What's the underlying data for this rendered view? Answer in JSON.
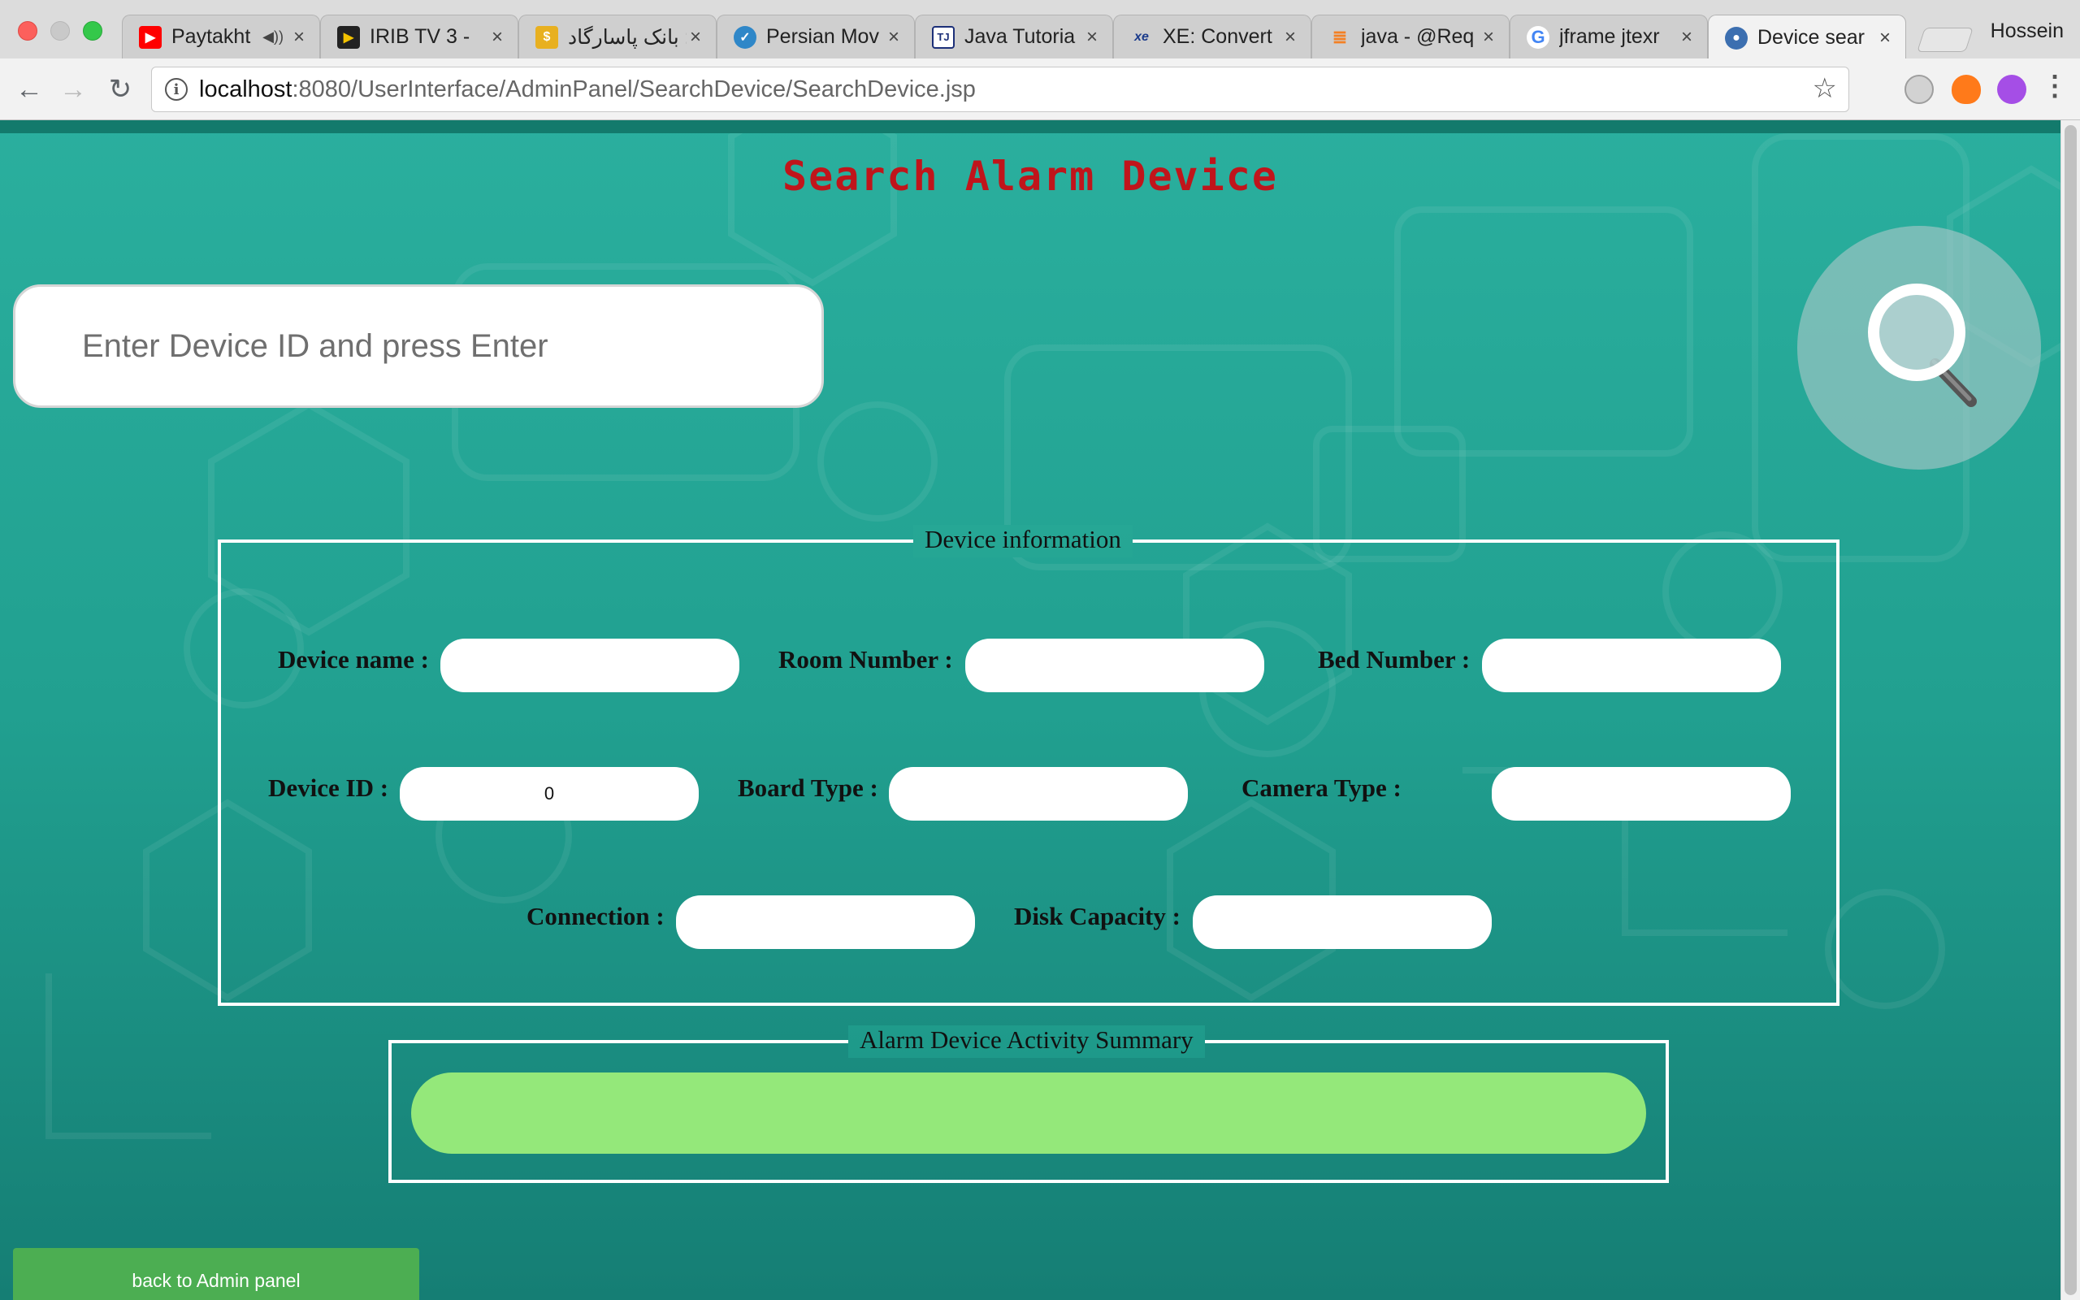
{
  "browser": {
    "profile_name": "Hossein",
    "tabs": [
      {
        "title": "Paytakht",
        "icon": "youtube-icon",
        "audio": true,
        "active": false
      },
      {
        "title": "IRIB TV 3 - ",
        "icon": "play-icon",
        "active": false
      },
      {
        "title": "بانک پاسارگاد ::",
        "icon": "bank-icon",
        "active": false
      },
      {
        "title": "Persian Mov",
        "icon": "bird-icon",
        "active": false
      },
      {
        "title": "Java Tutoria",
        "icon": "java-tutorial-icon",
        "active": false
      },
      {
        "title": "XE: Convert",
        "icon": "xe-icon",
        "active": false
      },
      {
        "title": "java - @Req",
        "icon": "stackoverflow-icon",
        "active": false
      },
      {
        "title": "jframe jtexr",
        "icon": "google-icon",
        "active": false
      },
      {
        "title": "Device sear",
        "icon": "admin-user-icon",
        "active": true
      }
    ],
    "url_host": "localhost",
    "url_rest": ":8080/UserInterface/AdminPanel/SearchDevice/SearchDevice.jsp"
  },
  "page": {
    "title": "Search Alarm Device",
    "search_placeholder": "Enter Device ID and press Enter",
    "device_info": {
      "legend": "Device information",
      "device_name_label": "Device name :",
      "room_number_label": "Room Number :",
      "bed_number_label": "Bed Number :",
      "device_id_label": "Device ID :",
      "device_id_value": "0",
      "board_type_label": "Board Type :",
      "camera_type_label": "Camera Type :",
      "connection_label": "Connection :",
      "disk_capacity_label": "Disk Capacity :"
    },
    "summary": {
      "legend": "Alarm Device Activity Summary"
    },
    "back_button_label": "back to Admin panel"
  },
  "colors": {
    "title_red": "#c0151b",
    "page_teal": "#21a090",
    "summary_green": "#94e87a",
    "back_button_green": "#4cae52"
  }
}
